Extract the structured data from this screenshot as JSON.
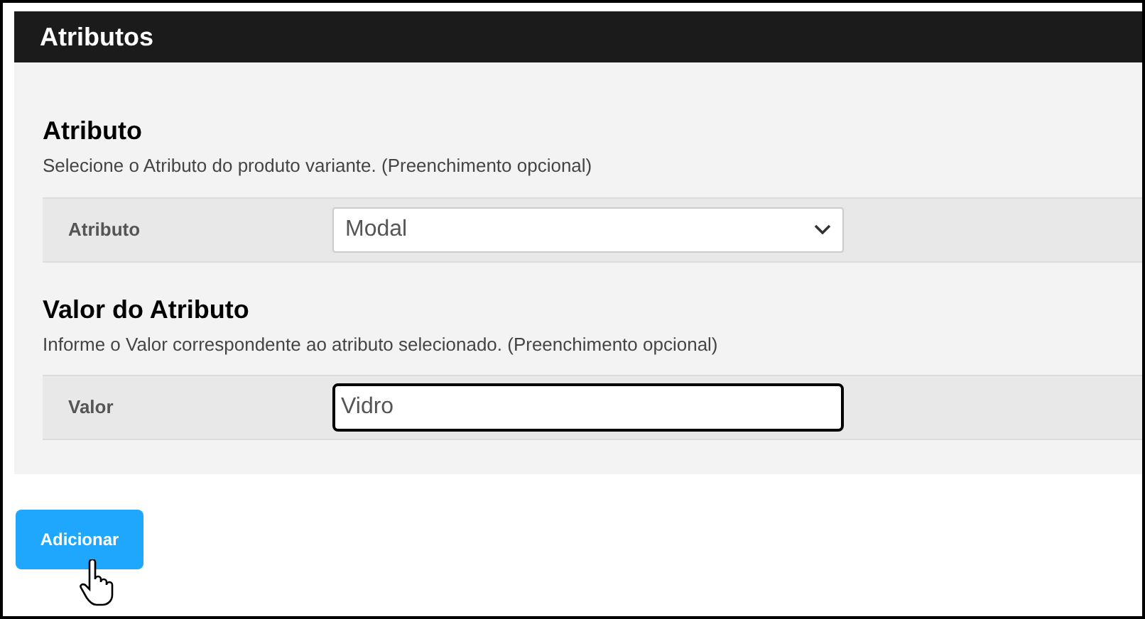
{
  "header": {
    "title": "Atributos"
  },
  "sections": [
    {
      "title": "Atributo",
      "description": "Selecione o Atributo do produto variante. (Preenchimento opcional)",
      "field": {
        "kind": "select",
        "label": "Atributo",
        "value": "Modal",
        "focused": false
      }
    },
    {
      "title": "Valor do Atributo",
      "description": "Informe o Valor correspondente ao atributo selecionado. (Preenchimento opcional)",
      "field": {
        "kind": "text",
        "label": "Valor",
        "value": "Vidro",
        "focused": true
      }
    }
  ],
  "button": {
    "label": "Adicionar"
  }
}
